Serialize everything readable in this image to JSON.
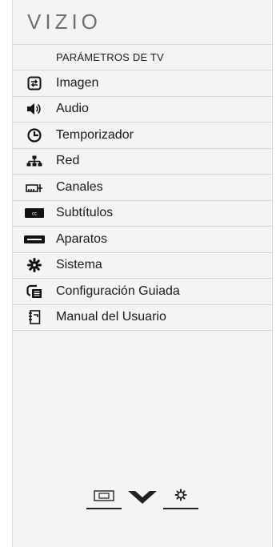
{
  "brand": {
    "logo_text": "VIZIO"
  },
  "menu": {
    "header": "PARÁMETROS DE TV",
    "items": [
      {
        "label": "Imagen",
        "icon": "picture-icon"
      },
      {
        "label": "Audio",
        "icon": "speaker-icon"
      },
      {
        "label": "Temporizador",
        "icon": "timer-icon"
      },
      {
        "label": "Red",
        "icon": "network-icon"
      },
      {
        "label": "Canales",
        "icon": "antenna-icon"
      },
      {
        "label": "Subtítulos",
        "icon": "cc-icon"
      },
      {
        "label": "Aparatos",
        "icon": "devices-icon"
      },
      {
        "label": "Sistema",
        "icon": "gear-icon"
      },
      {
        "label": "Configuración Guiada",
        "icon": "guided-setup-icon"
      },
      {
        "label": "Manual del Usuario",
        "icon": "manual-icon"
      }
    ]
  },
  "bottom_bar": {
    "buttons": [
      {
        "icon": "input-icon"
      },
      {
        "icon": "chevron-down-icon"
      },
      {
        "icon": "settings-icon"
      }
    ]
  }
}
